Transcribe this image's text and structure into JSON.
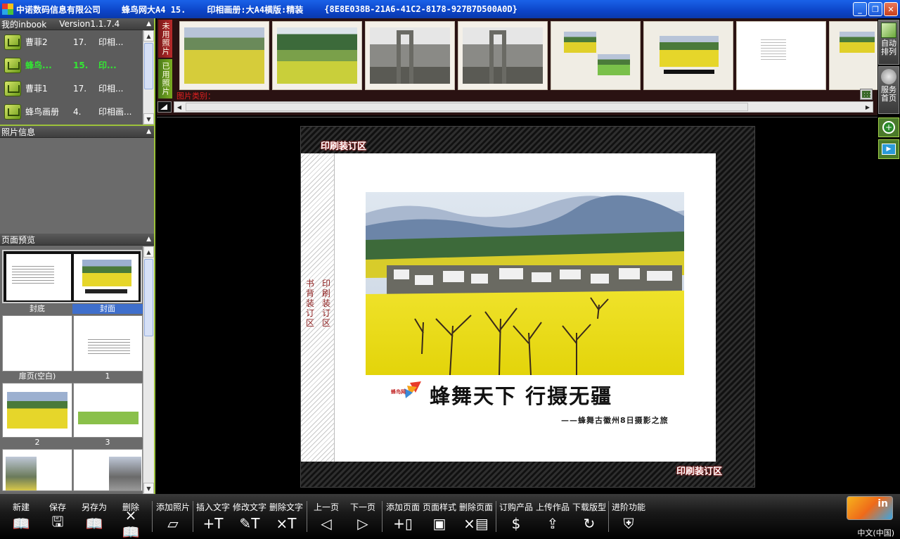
{
  "titlebar": {
    "company": "中诺数码信息有限公司",
    "album": "蜂鸟网大A4 15.",
    "product": "印相画册:大A4横版:精装",
    "guid": "{8E8E038B-21A6-41C2-8178-927B7D500A0D}"
  },
  "inbook": {
    "title": "我的inbook",
    "version": "Version1.1.7.4",
    "items": [
      {
        "name": "曹菲2",
        "count": "17.",
        "type": "印相..."
      },
      {
        "name": "蜂鸟...",
        "count": "15.",
        "type": "印..."
      },
      {
        "name": "曹菲1",
        "count": "17.",
        "type": "印相..."
      },
      {
        "name": "蜂鸟画册",
        "count": "4.",
        "type": "印相画..."
      }
    ]
  },
  "photo_info": {
    "title": "照片信息"
  },
  "page_preview": {
    "title": "页面预览",
    "labels": [
      "封底",
      "封面",
      "扉页(空白)",
      "1",
      "2",
      "3"
    ]
  },
  "strip": {
    "tab_unused": "未用照片",
    "tab_used": "已用照片",
    "status": "图片类别："
  },
  "right_tools": {
    "auto_arrange": "自动排列",
    "service_home": "服务首页"
  },
  "stage": {
    "bind_top": "印刷装订区",
    "bind_bottom": "印刷装订区",
    "spine_left": "书背装订区",
    "spine_right": "印刷装订区",
    "cover_title": "蜂舞天下 行摄无疆",
    "cover_subtitle": "——蜂舞古徽州8日摄影之旅",
    "logo_text": "蜂鸟网"
  },
  "toolbar": {
    "items": [
      "新建",
      "保存",
      "另存为",
      "删除",
      "添加照片",
      "插入文字",
      "修改文字",
      "删除文字",
      "上一页",
      "下一页",
      "添加页面",
      "页面样式",
      "删除页面",
      "订购产品",
      "上传作品",
      "下载版型",
      "进阶功能"
    ],
    "icons": [
      "book-icon",
      "floppy-icon",
      "save-as-icon",
      "delete-book-icon",
      "add-photo-icon",
      "insert-text-icon",
      "edit-text-icon",
      "delete-text-icon",
      "prev-page-icon",
      "next-page-icon",
      "add-page-icon",
      "page-style-icon",
      "delete-page-icon",
      "order-icon",
      "upload-icon",
      "download-icon",
      "advanced-icon"
    ],
    "language": "中文(中国)",
    "brand": "in"
  },
  "colors": {
    "accent_green": "#9cc23a",
    "titlebar_blue": "#0c44c8",
    "selected_green": "#33e833",
    "selected_blue": "#3f6fcc"
  }
}
